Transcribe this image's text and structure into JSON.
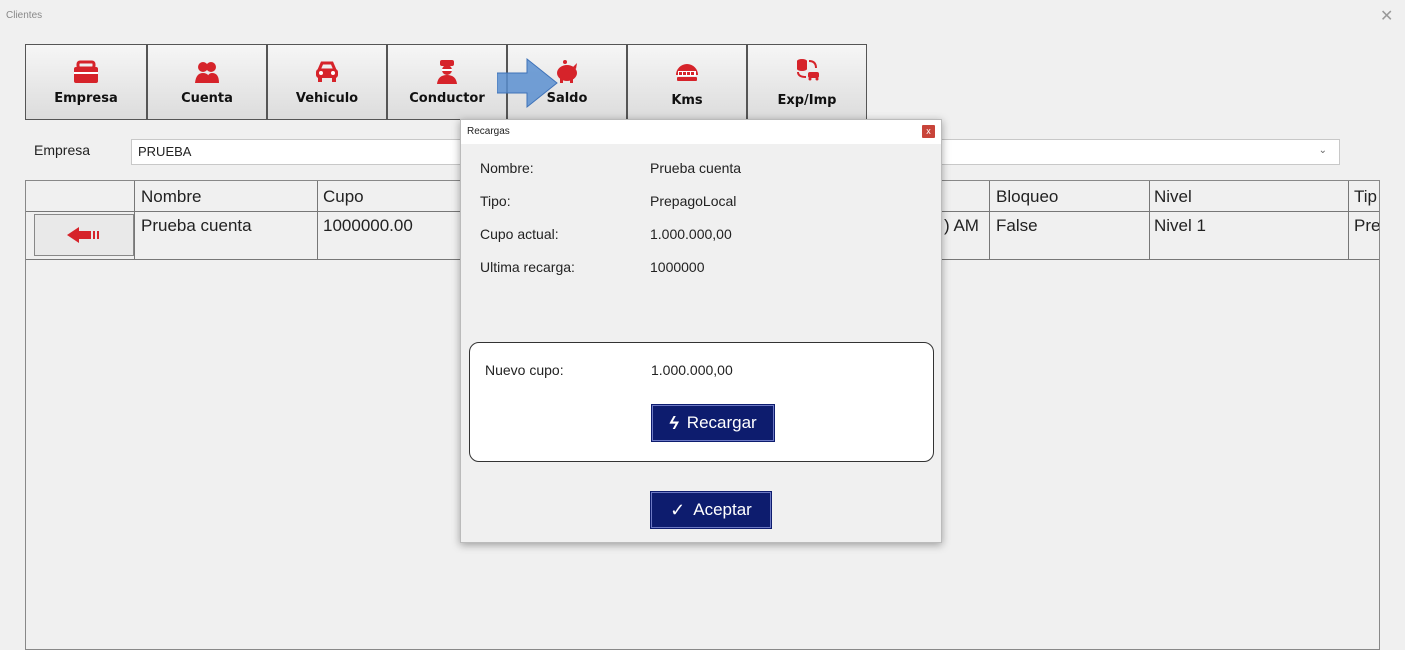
{
  "window": {
    "title": "Clientes",
    "close_glyph": "✕"
  },
  "toolbar": [
    {
      "label": "Empresa",
      "icon": "briefcase-icon"
    },
    {
      "label": "Cuenta",
      "icon": "users-icon"
    },
    {
      "label": "Vehiculo",
      "icon": "car-icon"
    },
    {
      "label": "Conductor",
      "icon": "driver-icon"
    },
    {
      "label": "Saldo",
      "icon": "piggy-bank-icon"
    },
    {
      "label": "Kms",
      "icon": "odometer-icon"
    },
    {
      "label": "Exp/Imp",
      "icon": "export-import-icon"
    }
  ],
  "filter": {
    "label": "Empresa",
    "value": "PRUEBA"
  },
  "grid": {
    "columns": [
      "Nombre",
      "Cupo",
      "Bloqueo",
      "Nivel",
      "Tip"
    ],
    "rows": [
      {
        "nombre": "Prueba cuenta",
        "cupo": "1000000.00",
        "fecha_fragment": ") AM",
        "bloqueo": "False",
        "nivel": "Nivel 1",
        "tipo_fragment": "Pre"
      }
    ]
  },
  "dialog": {
    "title": "Recargas",
    "close_glyph": "x",
    "fields": [
      {
        "label": "Nombre:",
        "value": "Prueba cuenta"
      },
      {
        "label": "Tipo:",
        "value": "PrepagoLocal"
      },
      {
        "label": "Cupo actual:",
        "value": "1.000.000,00"
      },
      {
        "label": "Ultima recarga:",
        "value": "1000000"
      }
    ],
    "nuevo_cupo_label": "Nuevo cupo:",
    "nuevo_cupo_value": "1.000.000,00",
    "recargar_label": "Recargar",
    "recargar_icon": "ϟ",
    "aceptar_label": "Aceptar",
    "aceptar_icon": "✓"
  },
  "colors": {
    "accent_red": "#d6232a",
    "button_navy": "#0d1c6e",
    "arrow_blue": "#5b8fd0"
  }
}
